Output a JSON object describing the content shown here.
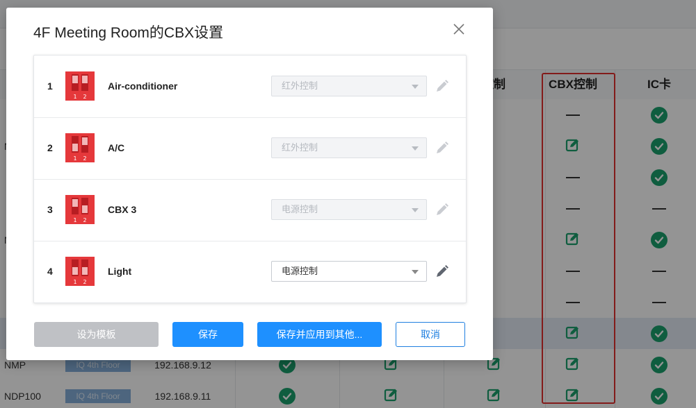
{
  "background": {
    "headers": {
      "col_control": "控制",
      "col_cbx": "CBX控制",
      "col_ic": "IC卡"
    },
    "rows": [
      {
        "name": "",
        "location": "",
        "ip": "",
        "cbx": "dash",
        "ic": "check"
      },
      {
        "name": "N",
        "location": "",
        "ip": "",
        "cbx": "edit",
        "ic": "check"
      },
      {
        "name": "",
        "location": "",
        "ip": "",
        "cbx": "dash",
        "ic": "check"
      },
      {
        "name": "",
        "location": "",
        "ip": "",
        "cbx": "dash",
        "ic": "dash"
      },
      {
        "name": "N",
        "location": "",
        "ip": "",
        "cbx": "edit",
        "ic": "check"
      },
      {
        "name": "",
        "location": "",
        "ip": "",
        "cbx": "dash",
        "ic": "dash"
      },
      {
        "name": "",
        "location": "",
        "ip": "",
        "cbx": "dash",
        "ic": "dash"
      },
      {
        "name": "",
        "location": "",
        "ip": "",
        "cbx": "edit",
        "ic": "check"
      },
      {
        "name": "NMP",
        "location": "IQ 4th Floor",
        "ip": "192.168.9.12",
        "cbx": "edit",
        "ic": "check"
      },
      {
        "name": "NDP100",
        "location": "IQ 4th Floor",
        "ip": "192.168.9.11",
        "cbx": "edit",
        "ic": "check"
      }
    ],
    "highlight_color": "#e2302e",
    "check_color": "#1aa06d"
  },
  "modal": {
    "title": "4F Meeting Room的CBX设置",
    "close_icon": "close-icon",
    "devices": [
      {
        "index": "1",
        "name": "Air-conditioner",
        "mode": "红外控制",
        "enabled": false,
        "dip_state": "both-up"
      },
      {
        "index": "2",
        "name": "A/C",
        "mode": "红外控制",
        "enabled": false,
        "dip_state": "first-down"
      },
      {
        "index": "3",
        "name": "CBX 3",
        "mode": "电源控制",
        "enabled": false,
        "dip_state": "second-down"
      },
      {
        "index": "4",
        "name": "Light",
        "mode": "电源控制",
        "enabled": true,
        "dip_state": "both-down"
      }
    ],
    "dip_labels": {
      "one": "1",
      "two": "2"
    },
    "buttons": {
      "set_template": "设为模板",
      "save": "保存",
      "save_apply": "保存并应用到其他...",
      "cancel": "取消"
    },
    "primary_color": "#1e90ff"
  }
}
